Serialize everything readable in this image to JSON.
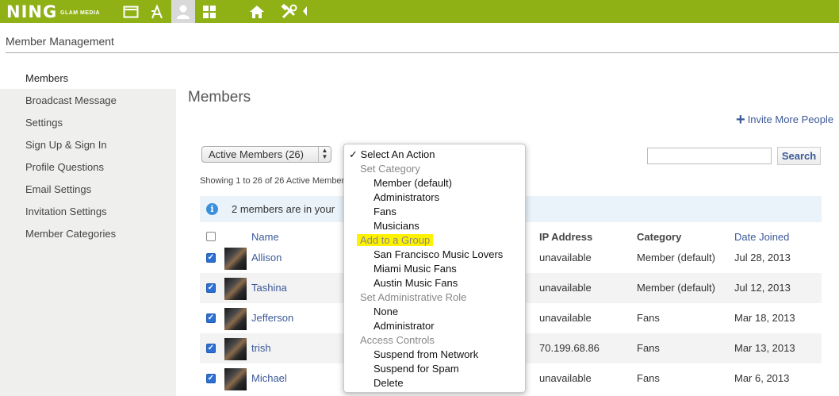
{
  "topbar": {
    "logo": "NING",
    "logo_sub": "GLAM MEDIA",
    "icons": [
      "window-icon",
      "app-store-icon",
      "person-icon",
      "grid-icon",
      "home-icon",
      "tools-icon",
      "collapse-arrow-icon"
    ],
    "color": "#8fb116"
  },
  "page": {
    "title": "Member Management"
  },
  "sidebar": {
    "items": [
      {
        "label": "Members",
        "active": true
      },
      {
        "label": "Broadcast Message"
      },
      {
        "label": "Settings"
      },
      {
        "label": "Sign Up & Sign In"
      },
      {
        "label": "Profile Questions"
      },
      {
        "label": "Email Settings"
      },
      {
        "label": "Invitation Settings"
      },
      {
        "label": "Member Categories"
      }
    ]
  },
  "main": {
    "title": "Members",
    "invite_label": "Invite More People",
    "filter_value": "Active Members (26)",
    "search_placeholder": "",
    "search_button": "Search",
    "showing": "Showing 1 to 26 of 26 Active Member",
    "info_text": "2 members are in your"
  },
  "table": {
    "headers": {
      "name": "Name",
      "ip": "IP Address",
      "category": "Category",
      "joined": "Date Joined"
    },
    "rows": [
      {
        "name": "Allison",
        "ip": "unavailable",
        "category": "Member (default)",
        "joined": "Jul 28, 2013",
        "checked": true
      },
      {
        "name": "Tashina",
        "ip": "unavailable",
        "category": "Member (default)",
        "joined": "Jul 12, 2013",
        "checked": true
      },
      {
        "name": "Jefferson",
        "ip": "unavailable",
        "category": "Fans",
        "joined": "Mar 18, 2013",
        "checked": true
      },
      {
        "name": "trish",
        "ip": "70.199.68.86",
        "category": "Fans",
        "joined": "Mar 13, 2013",
        "checked": true
      },
      {
        "name": "Michael",
        "ip": "unavailable",
        "category": "Fans",
        "joined": "Mar 6, 2013",
        "checked": true
      }
    ]
  },
  "menu": {
    "selected": "Select An Action",
    "groups": {
      "set_category": "Set Category",
      "add_group": "Add to a Group",
      "admin_role": "Set Administrative Role",
      "access": "Access Controls"
    },
    "category_options": [
      "Member (default)",
      "Administrators",
      "Fans",
      "Musicians"
    ],
    "group_options": [
      "San Francisco Music Lovers",
      "Miami Music Fans",
      "Austin Music Fans"
    ],
    "role_options": [
      "None",
      "Administrator"
    ],
    "access_options": [
      "Suspend from Network",
      "Suspend for Spam",
      "Delete"
    ]
  }
}
